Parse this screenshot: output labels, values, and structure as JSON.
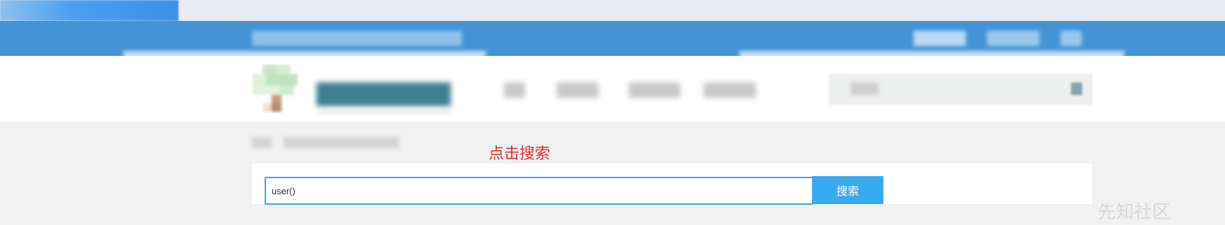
{
  "browser": {
    "tab_label": ""
  },
  "annotation": {
    "text": "点击搜索"
  },
  "search": {
    "input_value": "user()",
    "button_label": "搜索"
  },
  "watermark": {
    "text": "先知社区"
  },
  "colors": {
    "top_bar": "#4394d6",
    "search_border": "#39a9e8",
    "search_button": "#3aaaf0",
    "annotation": "#e03030"
  }
}
